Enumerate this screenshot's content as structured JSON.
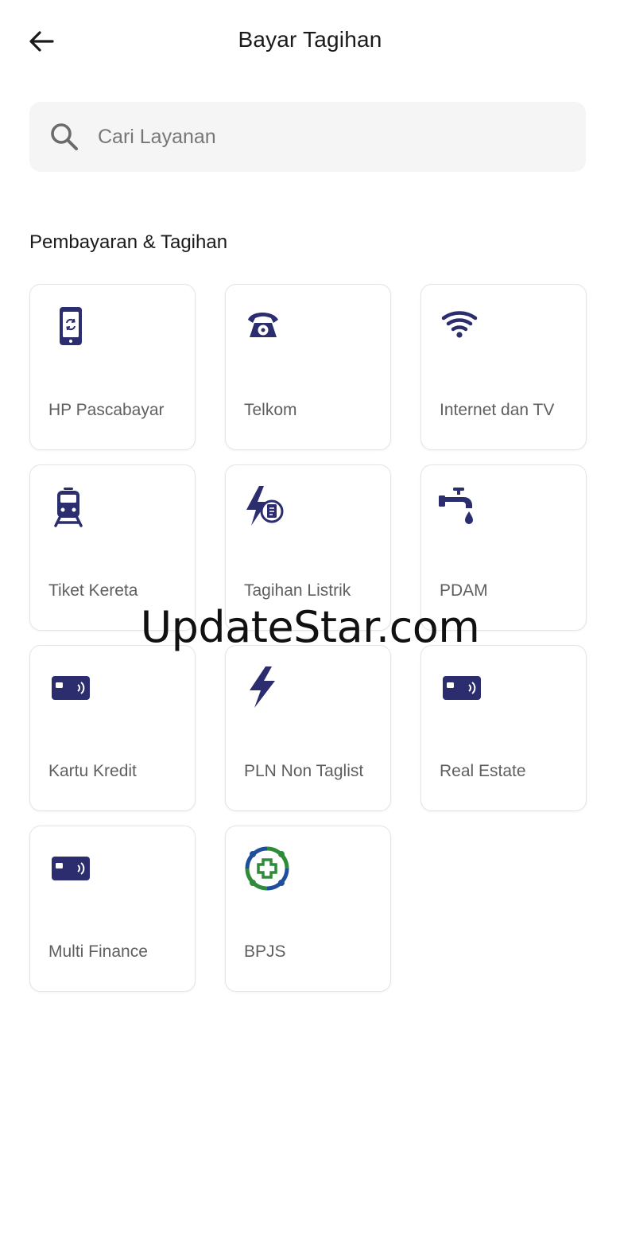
{
  "header": {
    "title": "Bayar Tagihan",
    "back_icon": "arrow-left-icon"
  },
  "search": {
    "placeholder": "Cari Layanan",
    "value": "",
    "icon": "search-icon"
  },
  "section": {
    "title": "Pembayaran & Tagihan"
  },
  "services": [
    {
      "label": "HP Pascabayar",
      "icon": "phone-sync-icon"
    },
    {
      "label": "Telkom",
      "icon": "telephone-icon"
    },
    {
      "label": "Internet dan TV",
      "icon": "wifi-icon"
    },
    {
      "label": "Tiket Kereta",
      "icon": "train-icon"
    },
    {
      "label": "Tagihan Listrik",
      "icon": "electric-bill-icon"
    },
    {
      "label": "PDAM",
      "icon": "water-tap-icon"
    },
    {
      "label": "Kartu Kredit",
      "icon": "contactless-card-icon"
    },
    {
      "label": "PLN Non Taglist",
      "icon": "lightning-icon"
    },
    {
      "label": "Real Estate",
      "icon": "contactless-card-icon"
    },
    {
      "label": "Multi Finance",
      "icon": "contactless-card-icon"
    },
    {
      "label": "BPJS",
      "icon": "bpjs-logo-icon"
    }
  ],
  "watermark": {
    "text": "UpdateStar.com"
  },
  "colors": {
    "icon_navy": "#2b2d6e",
    "bpjs_green": "#2e8b3a",
    "bpjs_blue": "#1f4e9c",
    "tile_border": "#e4e4e4",
    "search_bg": "#f5f5f5"
  }
}
